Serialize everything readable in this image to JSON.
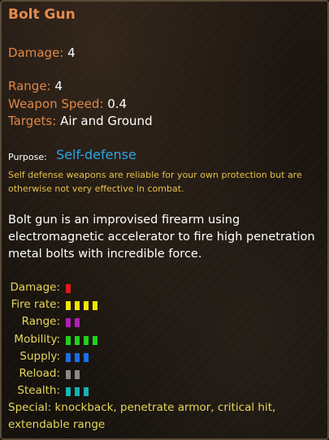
{
  "title": "Bolt Gun",
  "colors": {
    "title": "#e58a4f",
    "label": "#e1874a",
    "value": "#ffffff",
    "purpose": "#2aa6e6",
    "stat_label": "#e6d75a",
    "purpose_desc": "#e6c14b"
  },
  "damage": {
    "label": "Damage:",
    "value": "4"
  },
  "range": {
    "label": "Range:",
    "value": "4"
  },
  "weapon_speed": {
    "label": "Weapon Speed:",
    "value": "0.4"
  },
  "targets": {
    "label": "Targets:",
    "value": "Air and Ground"
  },
  "purpose": {
    "label": "Purpose:",
    "value": "Self-defense",
    "description": "Self defense weapons are reliable for your own protection but are otherwise not very effective in combat."
  },
  "description": "Bolt gun is an improvised firearm using electromagnetic accelerator to fire high penetration metal bolts with incredible force.",
  "stats": [
    {
      "label": "Damage:",
      "pips": 1,
      "color": "#e01a1a"
    },
    {
      "label": "Fire rate:",
      "pips": 4,
      "color": "#f2e600"
    },
    {
      "label": "Range:",
      "pips": 2,
      "color": "#b21fb8"
    },
    {
      "label": "Mobility:",
      "pips": 4,
      "color": "#22d11e"
    },
    {
      "label": "Supply:",
      "pips": 3,
      "color": "#1b6ee6"
    },
    {
      "label": "Reload:",
      "pips": 2,
      "color": "#8a8a8a"
    },
    {
      "label": "Stealth:",
      "pips": 3,
      "color": "#14b3b3"
    }
  ],
  "special": "Special: knockback, penetrate armor, critical hit, extendable range"
}
